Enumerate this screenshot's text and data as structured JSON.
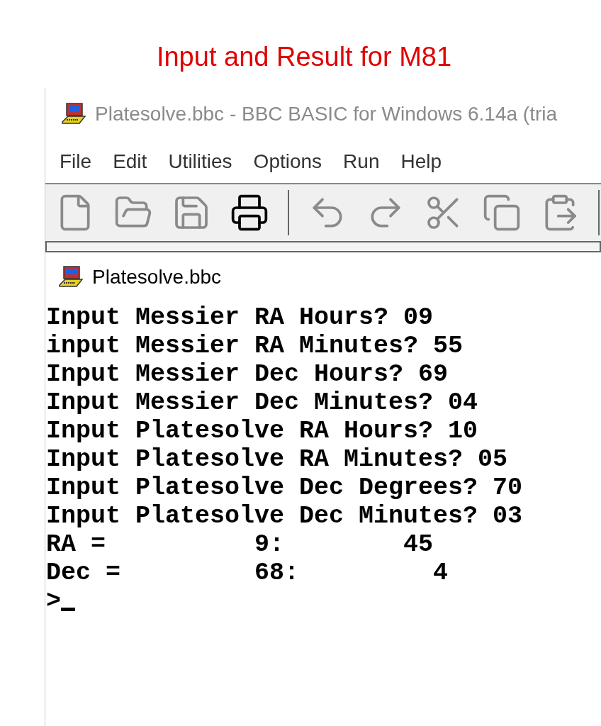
{
  "heading": "Input and Result for M81",
  "window": {
    "title": "Platesolve.bbc - BBC BASIC for Windows 6.14a (tria"
  },
  "menu": [
    "File",
    "Edit",
    "Utilities",
    "Options",
    "Run",
    "Help"
  ],
  "child_window": {
    "title": "Platesolve.bbc"
  },
  "console": {
    "lines": [
      "Input Messier RA Hours? 09",
      "input Messier RA Minutes? 55",
      "Input Messier Dec Hours? 69",
      "Input Messier Dec Minutes? 04",
      "Input Platesolve RA Hours? 10",
      "Input Platesolve RA Minutes? 05",
      "Input Platesolve Dec Degrees? 70",
      "Input Platesolve Dec Minutes? 03",
      "RA =          9:        45",
      "Dec =         68:         4"
    ],
    "prompt": ">"
  }
}
